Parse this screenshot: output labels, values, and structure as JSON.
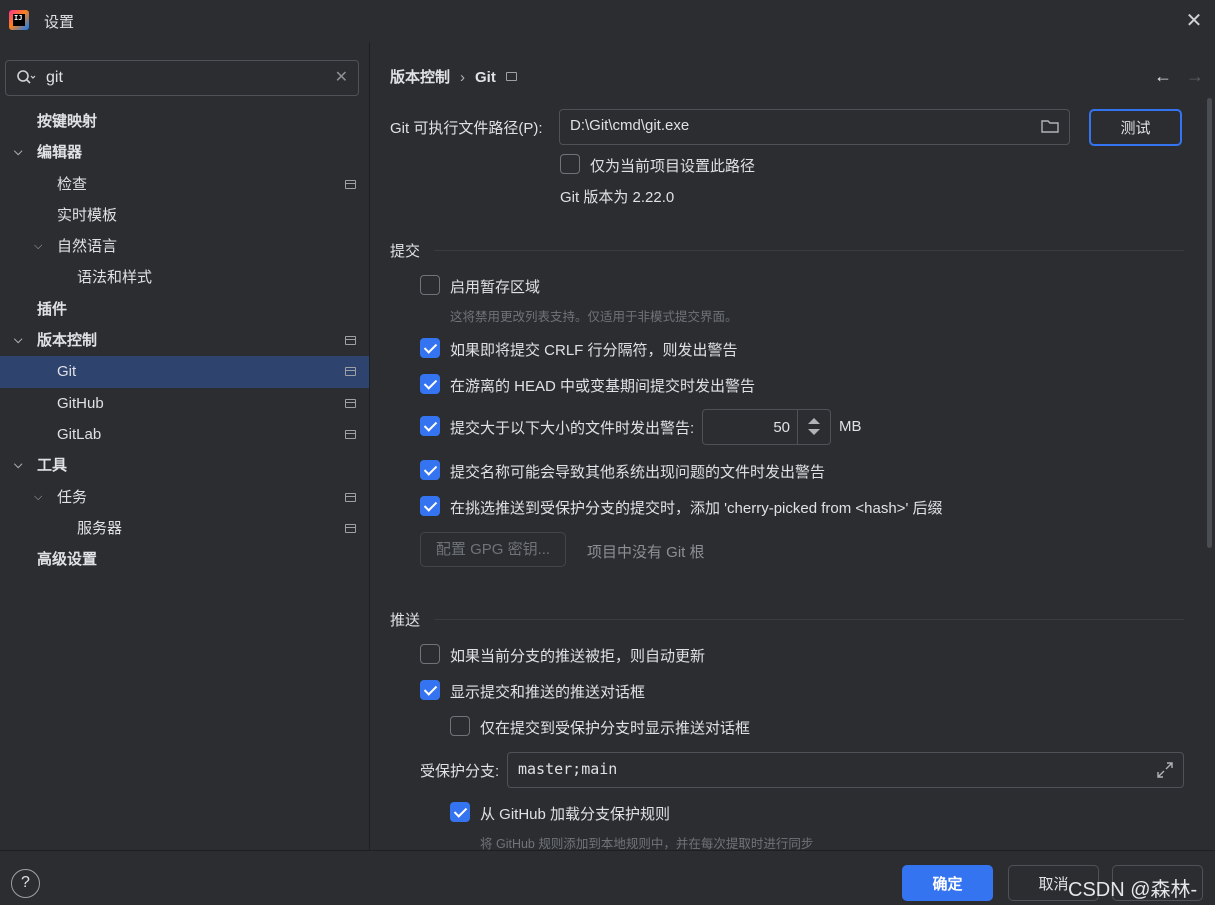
{
  "window": {
    "title": "设置",
    "icon": "intellij-idea-icon",
    "close_icon": "close-icon"
  },
  "search": {
    "value": "git",
    "icon": "search-icon",
    "clear_icon": "clear-icon"
  },
  "sidebar": {
    "items": [
      {
        "label": "按键映射"
      },
      {
        "label": "编辑器"
      },
      {
        "label": "检查"
      },
      {
        "label": "实时模板"
      },
      {
        "label": "自然语言"
      },
      {
        "label": "语法和样式"
      },
      {
        "label": "插件"
      },
      {
        "label": "版本控制"
      },
      {
        "label": "Git"
      },
      {
        "label": "GitHub"
      },
      {
        "label": "GitLab"
      },
      {
        "label": "工具"
      },
      {
        "label": "任务"
      },
      {
        "label": "服务器"
      },
      {
        "label": "高级设置"
      }
    ]
  },
  "breadcrumb": {
    "parent": "版本控制",
    "separator": "›",
    "current": "Git"
  },
  "git_path": {
    "label": "Git 可执行文件路径(P):",
    "value": "D:\\Git\\cmd\\git.exe",
    "test_button": "测试",
    "project_only": "仅为当前项目设置此路径",
    "version_text": "Git 版本为 2.22.0"
  },
  "commit": {
    "title": "提交",
    "staging": "启用暂存区域",
    "staging_hint": "这将禁用更改列表支持。仅适用于非模式提交界面。",
    "crlf": "如果即将提交 CRLF 行分隔符，则发出警告",
    "detached": "在游离的 HEAD 中或变基期间提交时发出警告",
    "large_file": "提交大于以下大小的文件时发出警告:",
    "large_file_value": "50",
    "large_file_unit": "MB",
    "bad_names": "提交名称可能会导致其他系统出现问题的文件时发出警告",
    "cherry_pick": "在挑选推送到受保护分支的提交时，添加 'cherry-picked from <hash>' 后缀",
    "gpg_button": "配置 GPG 密钥...",
    "no_root": "项目中没有 Git 根"
  },
  "push": {
    "title": "推送",
    "auto_update": "如果当前分支的推送被拒，则自动更新",
    "show_dialog": "显示提交和推送的推送对话框",
    "protected_only": "仅在提交到受保护分支时显示推送对话框",
    "protected_label": "受保护分支:",
    "protected_value": "master;main",
    "github_rules": "从 GitHub 加载分支保护规则",
    "github_hint": "将 GitHub 规则添加到本地规则中，并在每次提取时进行同步"
  },
  "footer": {
    "ok": "确定",
    "cancel": "取消",
    "watermark": "CSDN @森林-"
  },
  "colors": {
    "accent": "#3574f0",
    "background": "#2b2d30",
    "selected": "#2e436e"
  }
}
